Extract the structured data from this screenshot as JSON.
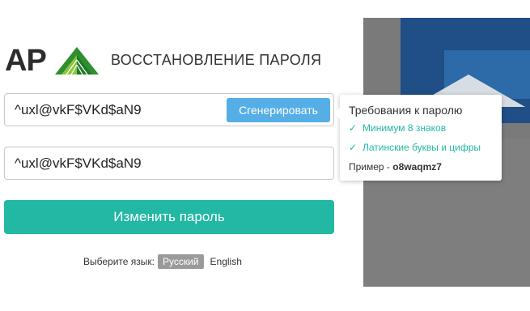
{
  "brand": {
    "logo_text": "AP",
    "accent": "#22b8a3",
    "logo_green": "#3aa83a"
  },
  "page": {
    "title": "ВОССТАНОВЛЕНИЕ ПАРОЛЯ"
  },
  "password_field": {
    "value": "^uxl@vkF$VKd$aN9",
    "generate_label": "Сгенерировать"
  },
  "confirm_field": {
    "value": "^uxl@vkF$VKd$aN9"
  },
  "submit": {
    "label": "Изменить пароль"
  },
  "language": {
    "label": "Выберите язык:",
    "options": [
      "Русский",
      "English"
    ],
    "selected": "Русский"
  },
  "requirements": {
    "title": "Требования к паролю",
    "items": [
      {
        "text": "Минимум 8 знаков",
        "icon": "check-icon",
        "met": true
      },
      {
        "text": "Латинские буквы и цифры",
        "icon": "check-icon",
        "met": true
      }
    ],
    "example_label": "Пример - ",
    "example_value": "o8waqmz7"
  },
  "colors": {
    "generate_button": "#55aee6",
    "submit_button": "#22b8a3",
    "language_selected_bg": "#9a9a9a"
  }
}
